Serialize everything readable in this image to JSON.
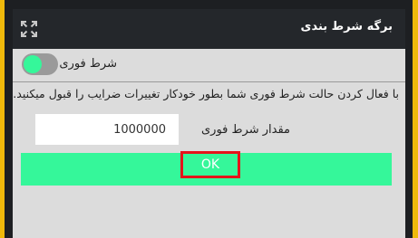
{
  "dialog": {
    "title": "برگه شرط بندی",
    "expand_icon": "expand-icon"
  },
  "instant_bet": {
    "label": "شرط فوری",
    "enabled": false,
    "toggle_color": "#35f79a"
  },
  "description": "با فعال کردن حالت شرط فوری شما بطور خودکار تغییرات ضرایب را قبول میکنید.",
  "amount": {
    "label": "مقدار شرط فوری",
    "value": "1000000"
  },
  "ok_button": {
    "label": "OK"
  },
  "colors": {
    "accent": "#35f79a",
    "frame": "#f0b90b",
    "header": "#24272b",
    "highlight": "#e4141b"
  }
}
